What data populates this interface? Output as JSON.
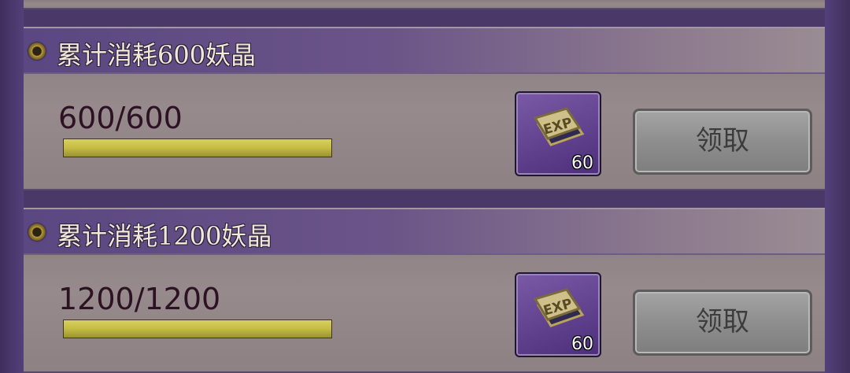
{
  "colors": {
    "panel_bg": "#4a3869",
    "bar_fill": "#c4bc42",
    "button_gray": "#8e8e8e"
  },
  "tasks": [
    {
      "title": "累计消耗600妖晶",
      "progress_text": "600/600",
      "progress_fraction": 1.0,
      "reward": {
        "icon": "exp-book-icon",
        "count": "60"
      },
      "claim_label": "领取"
    },
    {
      "title": "累计消耗1200妖晶",
      "progress_text": "1200/1200",
      "progress_fraction": 1.0,
      "reward": {
        "icon": "exp-book-icon",
        "count": "60"
      },
      "claim_label": "领取"
    }
  ]
}
